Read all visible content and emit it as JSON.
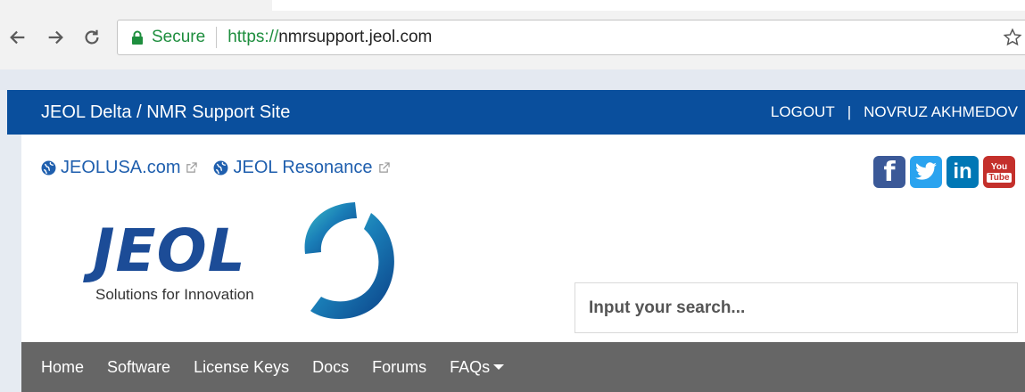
{
  "browser": {
    "secure_label": "Secure",
    "url_protocol": "https://",
    "url_host": "nmrsupport.jeol.com"
  },
  "site": {
    "title": "JEOL Delta / NMR Support Site",
    "logout_label": "LOGOUT",
    "separator": "|",
    "user_name": "NOVRUZ AKHMEDOV"
  },
  "ext_links": [
    {
      "label": "JEOLUSA.com",
      "icon": "globe-icon"
    },
    {
      "label": "JEOL Resonance",
      "icon": "globe-icon"
    }
  ],
  "social": {
    "facebook": "f",
    "linkedin": "in",
    "youtube_top": "You",
    "youtube_bottom": "Tube"
  },
  "logo": {
    "word": "JEOL",
    "tagline": "Solutions for Innovation"
  },
  "search": {
    "placeholder": "Input your search..."
  },
  "nav": [
    {
      "label": "Home"
    },
    {
      "label": "Software"
    },
    {
      "label": "License Keys"
    },
    {
      "label": "Docs"
    },
    {
      "label": "Forums"
    },
    {
      "label": "FAQs"
    }
  ],
  "colors": {
    "header_blue": "#0a4f9d",
    "nav_grey": "#666666",
    "link_blue": "#1f5fae",
    "secure_green": "#1e8e3e"
  }
}
